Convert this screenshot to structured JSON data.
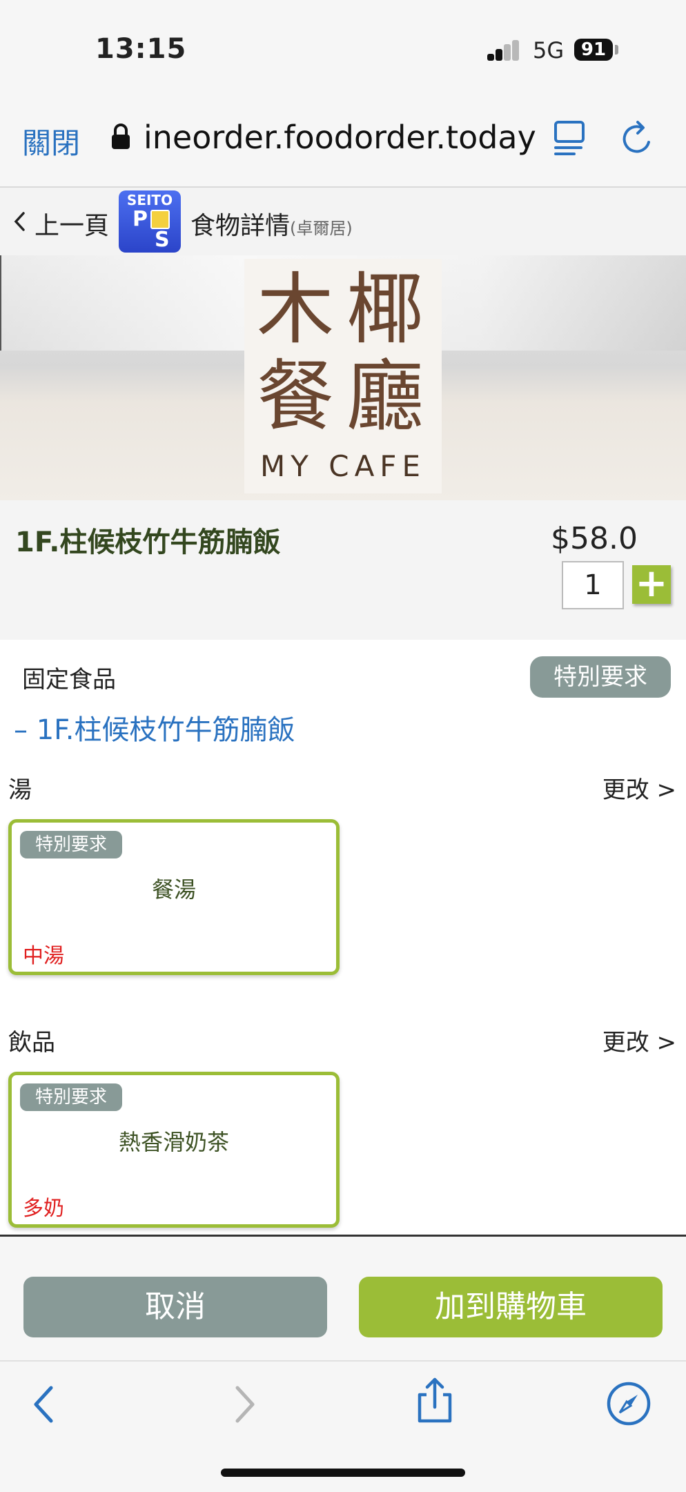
{
  "status": {
    "time": "13:15",
    "network": "5G",
    "battery": "91"
  },
  "browser": {
    "close_label": "關閉",
    "url": "ineorder.foodorder.today"
  },
  "nav": {
    "back_label": "上一頁",
    "logo_text": "SEITO",
    "logo_letters": [
      "P",
      "S"
    ],
    "title": "食物詳情",
    "subtitle": "(卓爾居)"
  },
  "banner": {
    "logo_chars": [
      "木",
      "椰",
      "餐",
      "廳"
    ],
    "logo_sub": "MY CAFE"
  },
  "product": {
    "name": "1F.柱候枝竹牛筋腩飯",
    "price": "$58.0",
    "quantity": "1",
    "add_symbol": "+"
  },
  "fixed": {
    "label": "固定食品",
    "special_label": "特別要求",
    "item": "– 1F.柱候枝竹牛筋腩飯"
  },
  "sections": [
    {
      "title": "湯",
      "change_label": "更改 >",
      "tag": "特別要求",
      "item": "餐湯",
      "note": "中湯"
    },
    {
      "title": "飲品",
      "change_label": "更改 >",
      "tag": "特別要求",
      "item": "熱香滑奶茶",
      "note": "多奶"
    }
  ],
  "actions": {
    "cancel_label": "取消",
    "add_to_cart_label": "加到購物車"
  },
  "colors": {
    "accent_green": "#9bbd37",
    "tag_gray": "#889a97",
    "link_blue": "#2a72c0",
    "note_red": "#e02020"
  },
  "toolbar_icons": [
    "back-icon",
    "forward-icon",
    "share-icon",
    "compass-icon"
  ]
}
